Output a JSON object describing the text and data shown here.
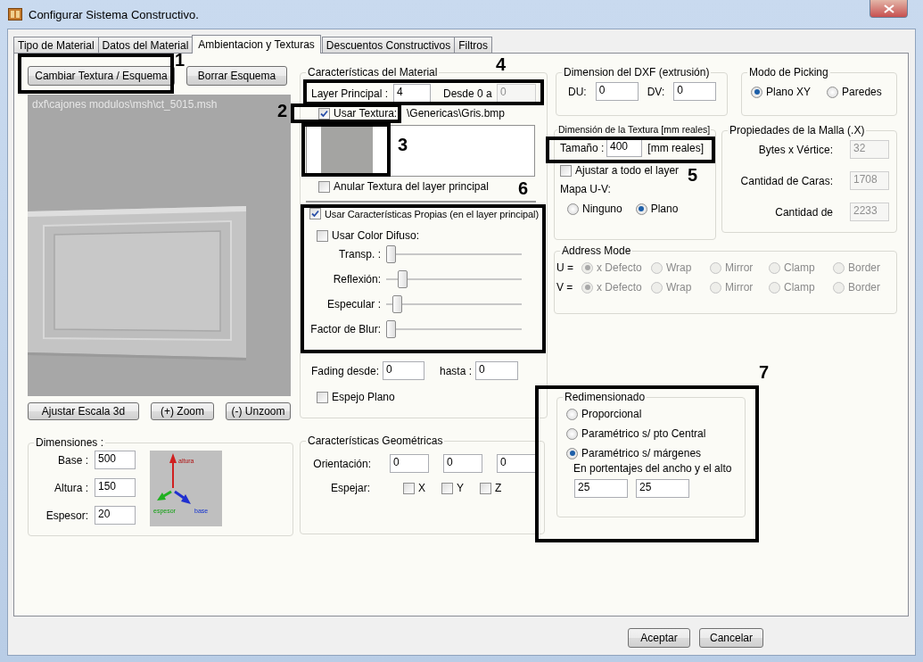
{
  "window": {
    "title": "Configurar Sistema Constructivo."
  },
  "tabs": [
    {
      "label": "Tipo de Material",
      "selected": false
    },
    {
      "label": "Datos del Material",
      "selected": false
    },
    {
      "label": "Ambientacion y Texturas",
      "selected": true
    },
    {
      "label": "Descuentos Constructivos",
      "selected": false
    },
    {
      "label": "Filtros",
      "selected": false
    }
  ],
  "left_panel": {
    "buttons": [
      "Cambiar Textura / Esquema",
      "Borrar Esquema"
    ],
    "preview": {
      "file_path": "dxf\\cajones modulos\\msh\\ct_5015.msh"
    },
    "view_buttons": [
      "Ajustar Escala 3d",
      "(+) Zoom",
      "(-) Unzoom"
    ],
    "dimensions": {
      "title": "Dimensiones :",
      "fields": [
        {
          "label": "Base :",
          "value": "500"
        },
        {
          "label": "Altura :",
          "value": "150"
        },
        {
          "label": "Espesor:",
          "value": "20"
        }
      ],
      "axes": {
        "vertical": "altura",
        "depth": "espesor",
        "horizontal": "base"
      }
    }
  },
  "material": {
    "title": "Características del Material",
    "layer_label": "Layer Principal :",
    "layer_value": "4",
    "range_label": "Desde 0 a",
    "range_value": "0",
    "range_disabled": true,
    "use_texture": {
      "label": "Usar Textura:",
      "checked": true
    },
    "texture_path": "\\Genericas\\Gris.bmp",
    "override_texture": {
      "label": "Anular Textura del layer principal",
      "checked": false
    },
    "own_properties": {
      "label": "Usar Características Propias (en el layer principal)",
      "checked": true
    },
    "diffuse_color": {
      "label": "Usar Color Difuso:",
      "checked": false
    },
    "sliders": [
      {
        "label": "Transp. :",
        "level": 0
      },
      {
        "label": "Reflexión:",
        "level": 0.09
      },
      {
        "label": "Especular :",
        "level": 0.05
      },
      {
        "label": "Factor de Blur:",
        "level": 0
      }
    ],
    "fading_from_label": "Fading desde:",
    "fading_from": "0",
    "fading_to_label": "hasta :",
    "fading_to": "0",
    "mirror_plane": {
      "label": "Espejo Plano",
      "checked": false
    }
  },
  "geometry": {
    "title": "Características Geométricas",
    "orientation_label": "Orientación:",
    "orientation": [
      "0",
      "0",
      "0"
    ],
    "mirror_label": "Espejar:",
    "mirror_axes": [
      {
        "label": "X",
        "checked": false
      },
      {
        "label": "Y",
        "checked": false
      },
      {
        "label": "Z",
        "checked": false
      }
    ]
  },
  "dxf": {
    "title": "Dimension del DXF (extrusión)",
    "fields": [
      {
        "label": "DU:",
        "value": "0"
      },
      {
        "label": "DV:",
        "value": "0"
      }
    ]
  },
  "picking": {
    "title": "Modo de Picking",
    "options": [
      {
        "label": "Plano XY",
        "selected": true
      },
      {
        "label": "Paredes",
        "selected": false
      }
    ]
  },
  "texture_size": {
    "title": "Dimensión de la Textura [mm reales]",
    "size_label": "Tamaño :",
    "size_value": "400",
    "unit": "[mm reales]",
    "fit_layer": {
      "label": "Ajustar a todo el layer",
      "checked": false
    },
    "uv_label": "Mapa U-V:",
    "uv_options": [
      {
        "label": "Ninguno",
        "selected": false
      },
      {
        "label": "Plano",
        "selected": true
      }
    ]
  },
  "mesh": {
    "title": "Propiedades de la Malla (.X)",
    "fields": [
      {
        "label": "Bytes x Vértice:",
        "value": "32",
        "disabled": true
      },
      {
        "label": "Cantidad de Caras:",
        "value": "1708",
        "disabled": true
      },
      {
        "label": "Cantidad de",
        "value": "2233",
        "disabled": true
      }
    ]
  },
  "address_mode": {
    "title": "Address Mode",
    "disabled": true,
    "rows": [
      {
        "label": "U =",
        "options": [
          {
            "label": "x Defecto",
            "selected": true
          },
          {
            "label": "Wrap",
            "selected": false
          },
          {
            "label": "Mirror",
            "selected": false
          },
          {
            "label": "Clamp",
            "selected": false
          },
          {
            "label": "Border",
            "selected": false
          }
        ]
      },
      {
        "label": "V =",
        "options": [
          {
            "label": "x Defecto",
            "selected": true
          },
          {
            "label": "Wrap",
            "selected": false
          },
          {
            "label": "Mirror",
            "selected": false
          },
          {
            "label": "Clamp",
            "selected": false
          },
          {
            "label": "Border",
            "selected": false
          }
        ]
      }
    ]
  },
  "resize": {
    "title": "Redimensionado",
    "options": [
      {
        "label": "Proporcional",
        "selected": false
      },
      {
        "label": "Paramétrico s/ pto Central",
        "selected": false
      },
      {
        "label": "Paramétrico s/ márgenes",
        "selected": true
      }
    ],
    "hint": "En portentajes del ancho y el alto",
    "values": [
      "25",
      "25"
    ]
  },
  "annotations": [
    {
      "number": "1"
    },
    {
      "number": "2"
    },
    {
      "number": "3"
    },
    {
      "number": "4"
    },
    {
      "number": "5"
    },
    {
      "number": "6"
    },
    {
      "number": "7"
    }
  ],
  "buttons": [
    "Aceptar",
    "Cancelar"
  ]
}
